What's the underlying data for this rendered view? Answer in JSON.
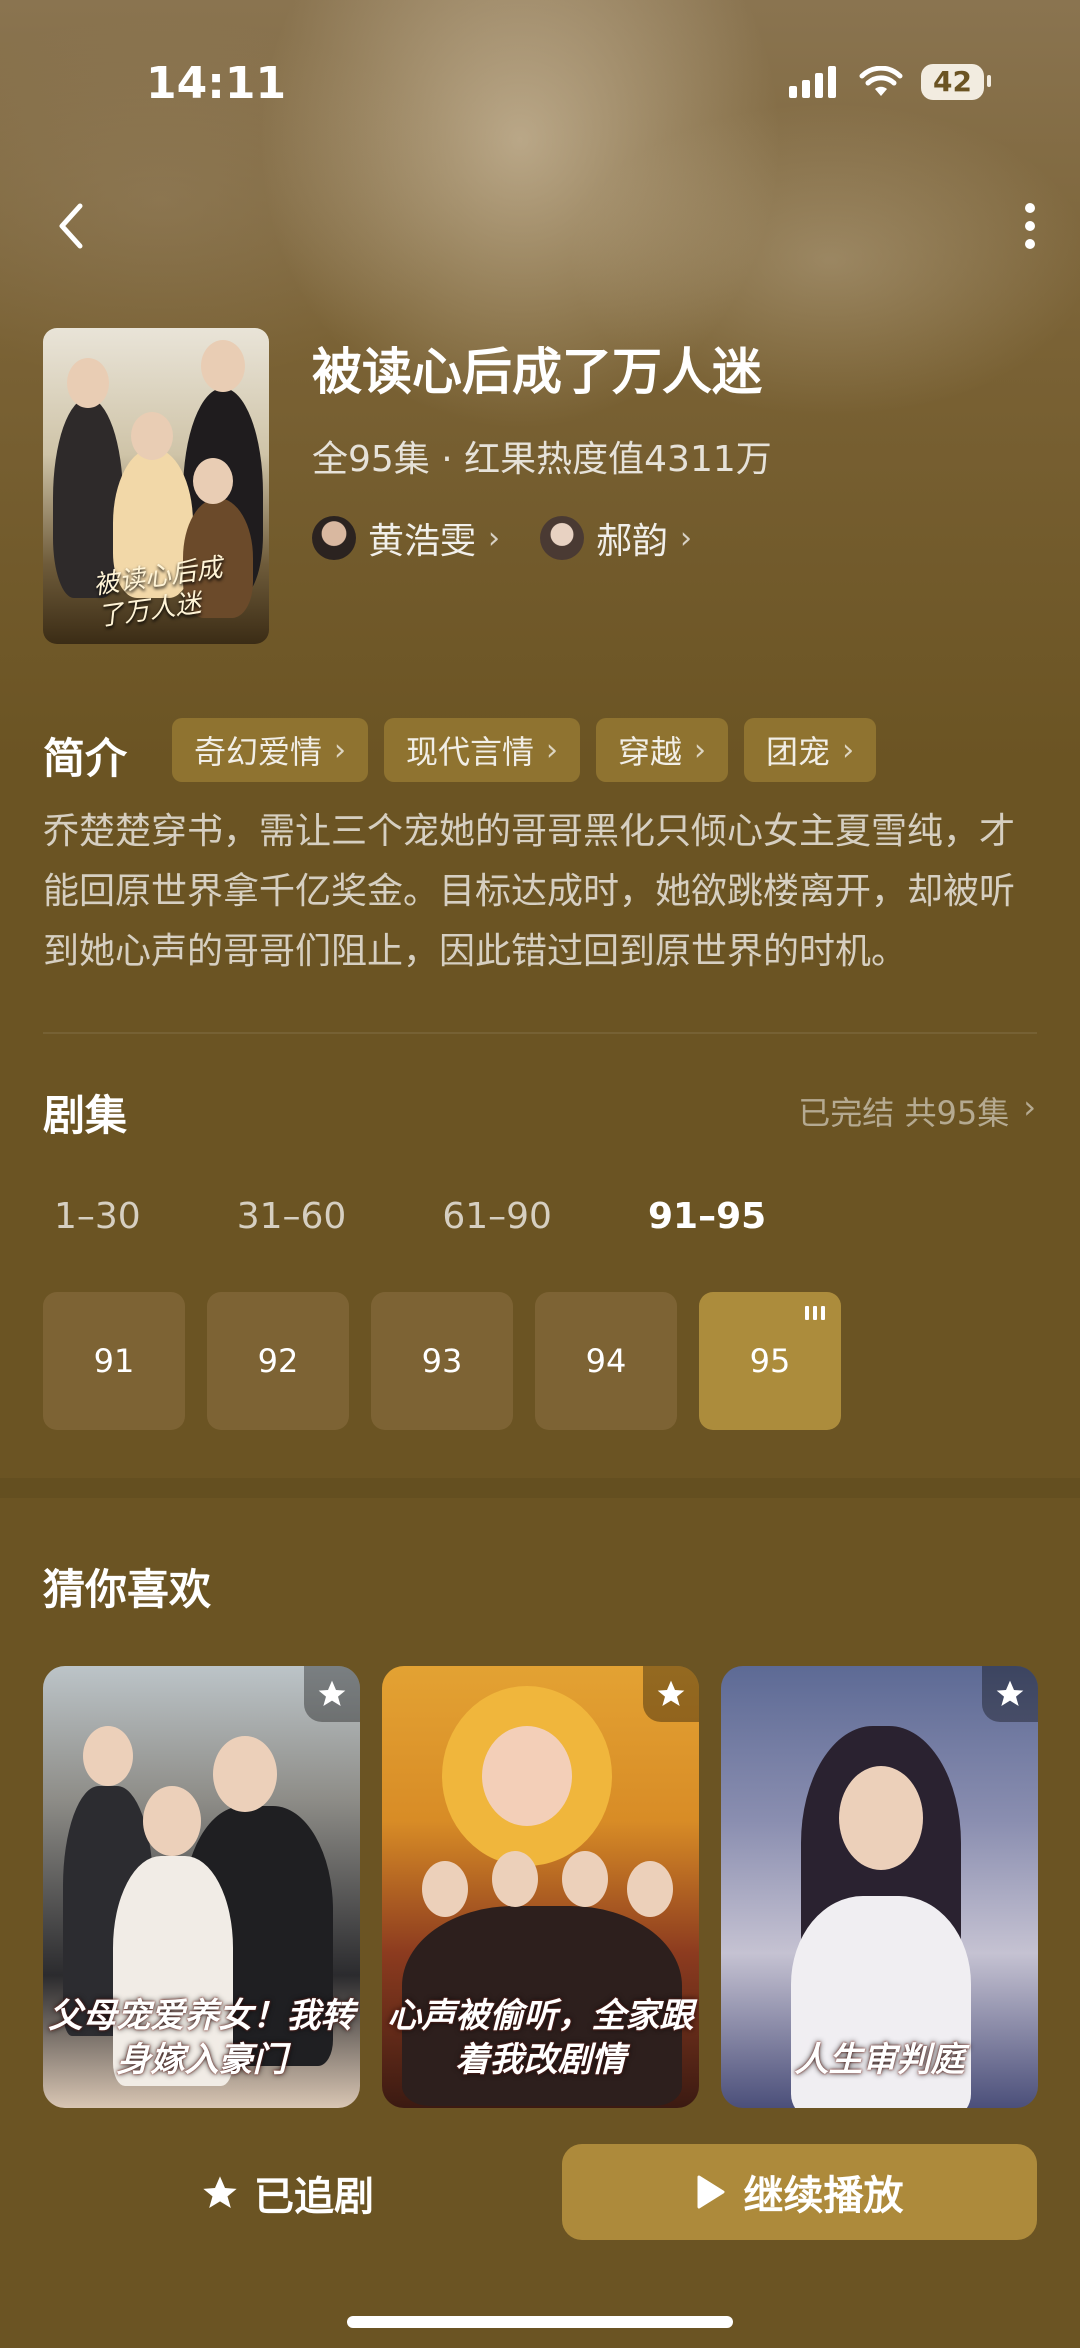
{
  "status_bar": {
    "time": "14:11",
    "battery": "42"
  },
  "drama": {
    "title": "被读心后成了万人迷",
    "poster_title": "被读心后成了万人迷",
    "meta": "全95集 · 红果热度值4311万",
    "actors": [
      {
        "name": "黄浩雯"
      },
      {
        "name": "郝韵"
      }
    ]
  },
  "intro": {
    "label": "简介",
    "tags": [
      "奇幻爱情",
      "现代言情",
      "穿越",
      "团宠"
    ],
    "synopsis": "乔楚楚穿书，需让三个宠她的哥哥黑化只倾心女主夏雪纯，才能回原世界拿千亿奖金。目标达成时，她欲跳楼离开，却被听到她心声的哥哥们阻止，因此错过回到原世界的时机。"
  },
  "episodes": {
    "label": "剧集",
    "status": "已完结 共95集",
    "ranges": [
      "1–30",
      "31–60",
      "61–90",
      "91–95"
    ],
    "active_range": "91–95",
    "items": [
      "91",
      "92",
      "93",
      "94",
      "95"
    ],
    "current": "95"
  },
  "recommend": {
    "label": "猜你喜欢",
    "items": [
      {
        "title": "父母宠爱养女！我转身嫁入豪门"
      },
      {
        "title": "心声被偷听，全家跟着我改剧情"
      },
      {
        "title": "人生审判庭"
      }
    ]
  },
  "bottom_bar": {
    "follow_label": "已追剧",
    "play_label": "继续播放"
  },
  "colors": {
    "background": "#6b5423",
    "accent": "#ad8a3b",
    "tag_bg": "#8f7330"
  }
}
